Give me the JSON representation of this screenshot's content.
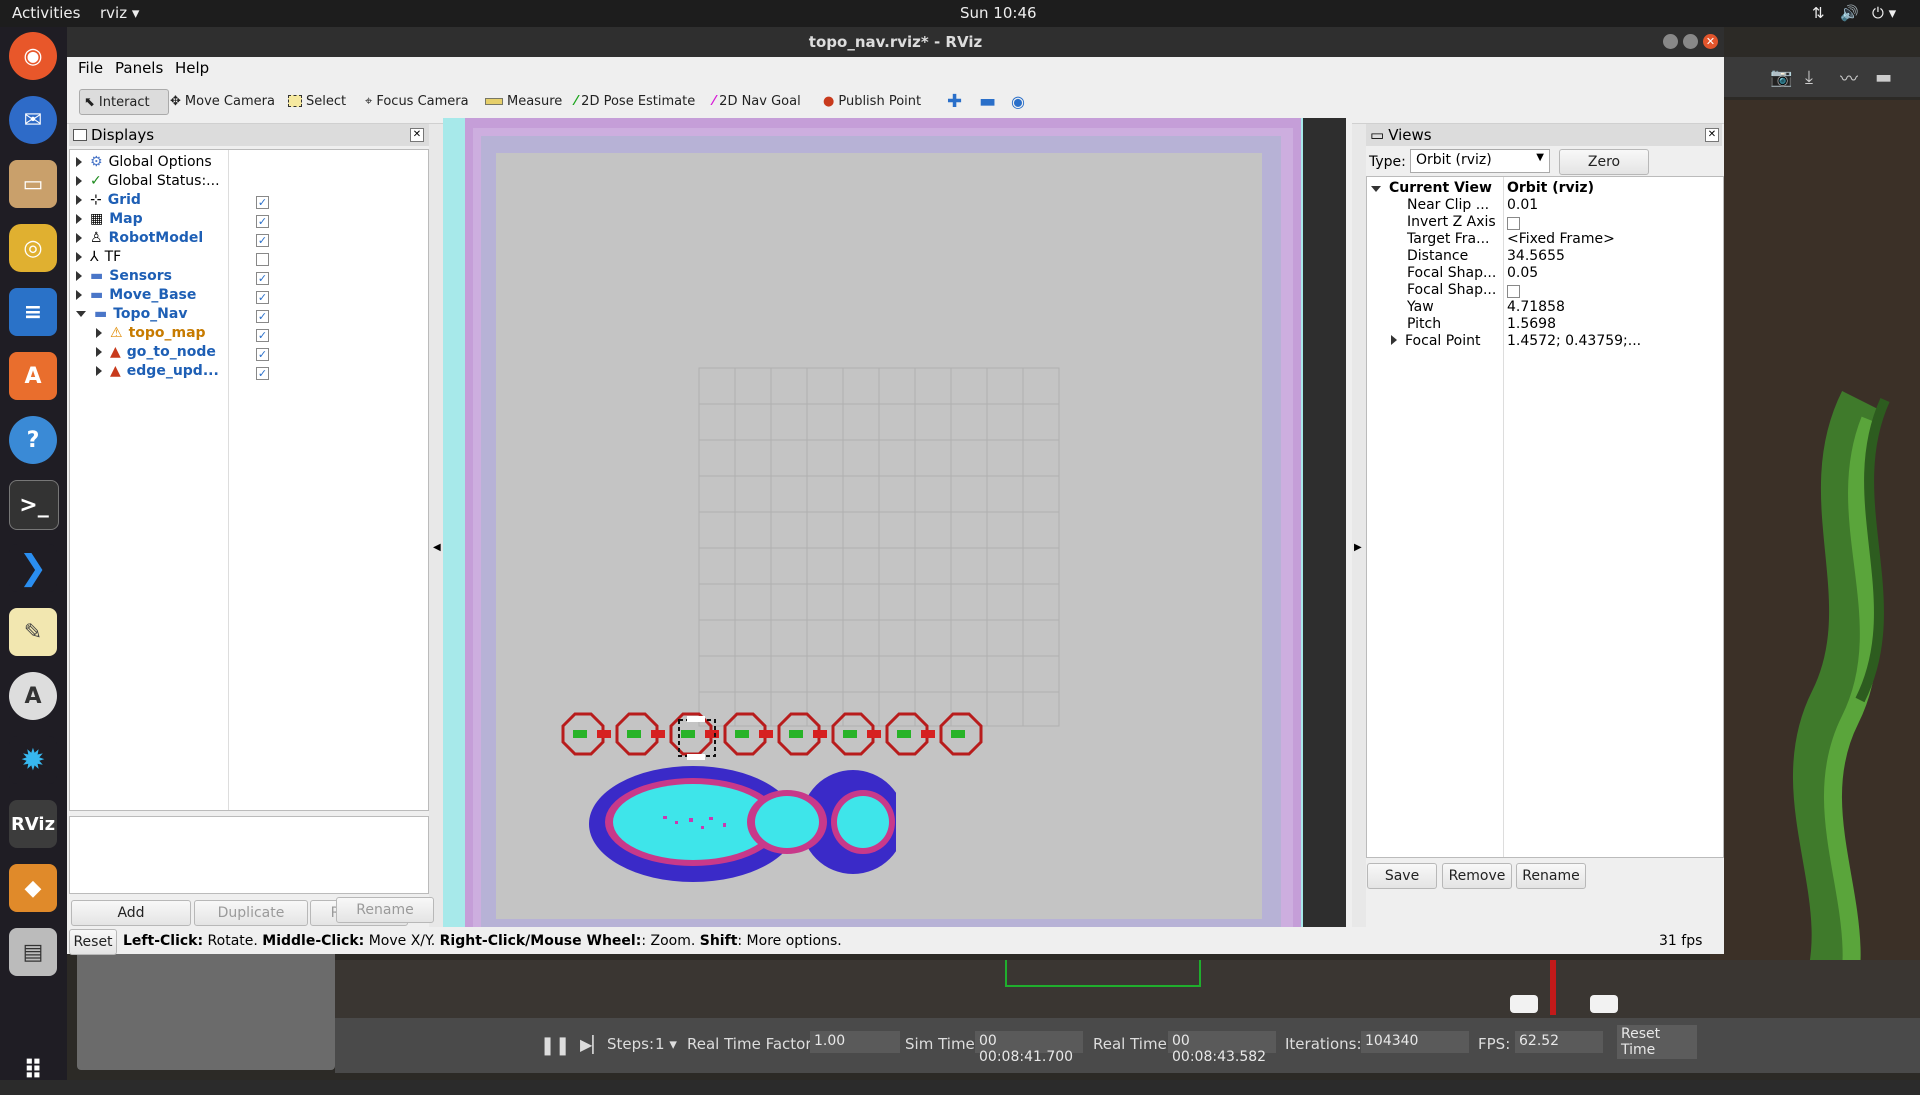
{
  "topbar": {
    "activities": "Activities",
    "app": "rviz",
    "clock": "Sun 10:46"
  },
  "dock": {
    "items": [
      "firefox-icon",
      "thunderbird-icon",
      "files-icon",
      "rhythmbox-icon",
      "writer-icon",
      "software-center-icon",
      "help-icon",
      "terminal-icon",
      "vscode-icon",
      "text-editor-icon",
      "software-updater-icon",
      "settings-icon",
      "rviz-icon",
      "layers-icon",
      "scanner-icon",
      "apps-grid-icon"
    ]
  },
  "window": {
    "title": "topo_nav.rviz* - RViz"
  },
  "menu": {
    "file": "File",
    "panels": "Panels",
    "help": "Help"
  },
  "toolbar": {
    "interact": "Interact",
    "move_camera": "Move Camera",
    "select": "Select",
    "focus_camera": "Focus Camera",
    "measure": "Measure",
    "pose_estimate": "2D Pose Estimate",
    "nav_goal": "2D Nav Goal",
    "publish_point": "Publish Point"
  },
  "displays": {
    "title": "Displays",
    "items": [
      {
        "name": "Global Options",
        "checked": null
      },
      {
        "name": "Global Status:...",
        "checked": null
      },
      {
        "name": "Grid",
        "checked": true
      },
      {
        "name": "Map",
        "checked": true
      },
      {
        "name": "RobotModel",
        "checked": true
      },
      {
        "name": "TF",
        "checked": false
      },
      {
        "name": "Sensors",
        "checked": true
      },
      {
        "name": "Move_Base",
        "checked": true
      },
      {
        "name": "Topo_Nav",
        "checked": true
      },
      {
        "name": "topo_map",
        "checked": true
      },
      {
        "name": "go_to_node",
        "checked": true
      },
      {
        "name": "edge_upd...",
        "checked": true
      }
    ],
    "buttons": {
      "add": "Add",
      "duplicate": "Duplicate",
      "remove": "Remove",
      "rename": "Rename"
    }
  },
  "views": {
    "title": "Views",
    "type_label": "Type:",
    "type_value": "Orbit (rviz)",
    "zero": "Zero",
    "props": [
      {
        "name": "Current View",
        "value": "Orbit (rviz)"
      },
      {
        "name": "Near Clip ...",
        "value": "0.01"
      },
      {
        "name": "Invert Z Axis",
        "value": ""
      },
      {
        "name": "Target Fra...",
        "value": "<Fixed Frame>"
      },
      {
        "name": "Distance",
        "value": "34.5655"
      },
      {
        "name": "Focal Shap...",
        "value": "0.05"
      },
      {
        "name": "Focal Shap...",
        "value": ""
      },
      {
        "name": "Yaw",
        "value": "4.71858"
      },
      {
        "name": "Pitch",
        "value": "1.5698"
      },
      {
        "name": "Focal Point",
        "value": "1.4572; 0.43759;..."
      }
    ],
    "buttons": {
      "save": "Save",
      "remove": "Remove",
      "rename": "Rename"
    },
    "fps": "31 fps"
  },
  "statusbar": {
    "reset": "Reset",
    "left_click": "Left-Click:",
    "left_desc": " Rotate. ",
    "middle_click": "Middle-Click:",
    "middle_desc": " Move X/Y. ",
    "right_click": "Right-Click/Mouse Wheel:",
    "right_desc": ": Zoom. ",
    "shift": "Shift",
    "shift_desc": ": More options."
  },
  "gazebo": {
    "steps_label": "Steps:",
    "steps_value": "1",
    "rtf_label": "Real Time Factor:",
    "rtf_value": "1.00",
    "sim_label": "Sim Time:",
    "sim_value": "00 00:08:41.700",
    "real_label": "Real Time:",
    "real_value": "00 00:08:43.582",
    "iter_label": "Iterations:",
    "iter_value": "104340",
    "fps_label": "FPS:",
    "fps_value": "62.52",
    "reset_time": "Reset Time"
  }
}
